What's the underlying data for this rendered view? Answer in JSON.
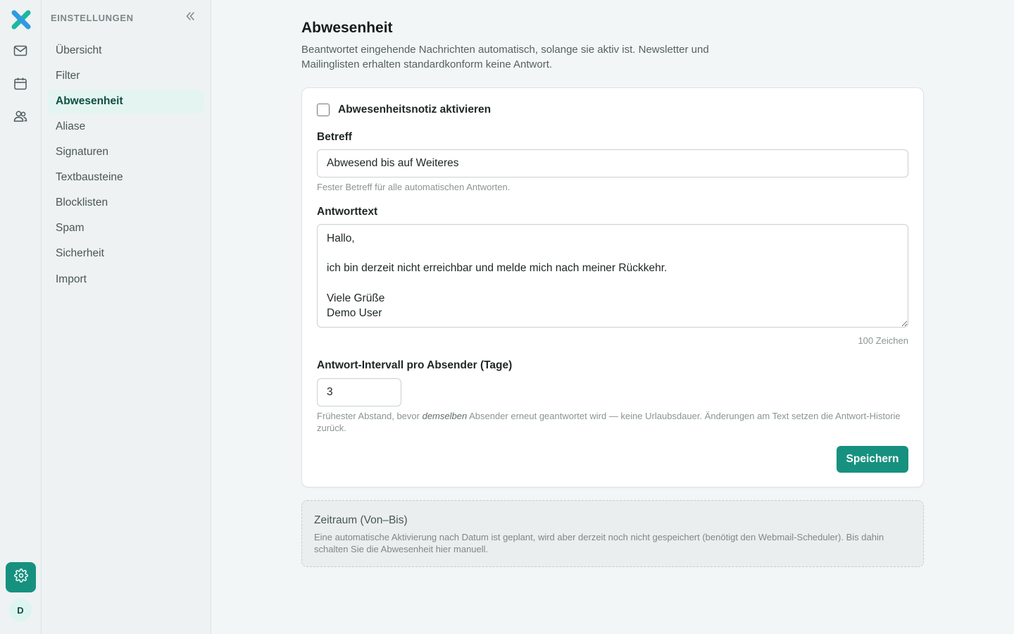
{
  "colors": {
    "accent": "#17917f",
    "active_bg": "#e4f5f1",
    "sidebar_bg": "#eef2f2",
    "page_bg": "#f3f6f6"
  },
  "rail": {
    "logo_icon": "x-logo-icon",
    "items": [
      {
        "icon": "mail-icon"
      },
      {
        "icon": "calendar-icon"
      },
      {
        "icon": "users-icon"
      }
    ],
    "settings_icon": "gear-icon",
    "avatar_initial": "D"
  },
  "sidebar": {
    "title": "EINSTELLUNGEN",
    "collapse_icon": "chevrons-left-icon",
    "items": [
      {
        "label": "Übersicht"
      },
      {
        "label": "Filter"
      },
      {
        "label": "Abwesenheit",
        "active": true
      },
      {
        "label": "Aliase"
      },
      {
        "label": "Signaturen"
      },
      {
        "label": "Textbausteine"
      },
      {
        "label": "Blocklisten"
      },
      {
        "label": "Spam"
      },
      {
        "label": "Sicherheit"
      },
      {
        "label": "Import"
      }
    ]
  },
  "main": {
    "title": "Abwesenheit",
    "description": "Beantwortet eingehende Nachrichten automatisch, solange sie aktiv ist. Newsletter und Mailinglisten erhalten standardkonform keine Antwort.",
    "form": {
      "enable_label": "Abwesenheitsnotiz aktivieren",
      "enabled": false,
      "subject_label": "Betreff",
      "subject_value": "Abwesend bis auf Weiteres",
      "subject_hint": "Fester Betreff für alle automatischen Antworten.",
      "body_label": "Antworttext",
      "body_value": "Hallo,\n\nich bin derzeit nicht erreichbar und melde mich nach meiner Rückkehr.\n\nViele Grüße\nDemo User",
      "body_counter": "100 Zeichen",
      "interval_label": "Antwort-Intervall pro Absender (Tage)",
      "interval_value": "3",
      "interval_hint_pre": "Frühester Abstand, bevor ",
      "interval_hint_em": "demselben",
      "interval_hint_post": " Absender erneut geantwortet wird — keine Urlaubsdauer. Änderungen am Text setzen die Antwort-Historie zurück.",
      "save_label": "Speichern"
    },
    "schedule_note": {
      "title": "Zeitraum (Von–Bis)",
      "text": "Eine automatische Aktivierung nach Datum ist geplant, wird aber derzeit noch nicht gespeichert (benötigt den Webmail-Scheduler). Bis dahin schalten Sie die Abwesenheit hier manuell."
    }
  }
}
